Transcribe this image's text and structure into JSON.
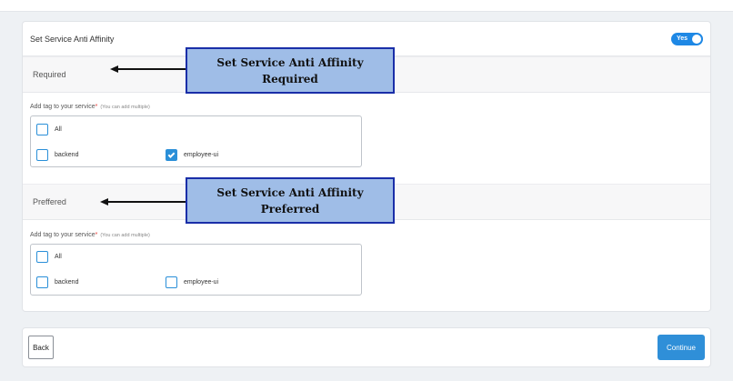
{
  "card": {
    "title": "Set Service Anti Affinity",
    "toggle_label": "Yes"
  },
  "required": {
    "section_label": "Required",
    "tag_label": "Add tag to your service",
    "required_mark": "*",
    "tag_hint": "(You can add multiple)",
    "options": [
      {
        "label": "All",
        "checked": false
      },
      {
        "label": "backend",
        "checked": false
      },
      {
        "label": "employee-ui",
        "checked": true
      }
    ]
  },
  "preferred": {
    "section_label": "Preffered",
    "tag_label": "Add tag to your service",
    "required_mark": "*",
    "tag_hint": "(You can add multiple)",
    "options": [
      {
        "label": "All",
        "checked": false
      },
      {
        "label": "backend",
        "checked": false
      },
      {
        "label": "employee-ui",
        "checked": false
      }
    ]
  },
  "callouts": {
    "required": {
      "line1": "Set Service Anti Affinity",
      "line2": "Required"
    },
    "preferred": {
      "line1": "Set Service Anti Affinity",
      "line2": "Preferred"
    }
  },
  "footer": {
    "back_label": "Back",
    "continue_label": "Continue"
  },
  "colors": {
    "accent": "#1e88e5",
    "callout_fill": "#9fbde7",
    "callout_border": "#1a2ea8",
    "required_star": "#e53935"
  }
}
